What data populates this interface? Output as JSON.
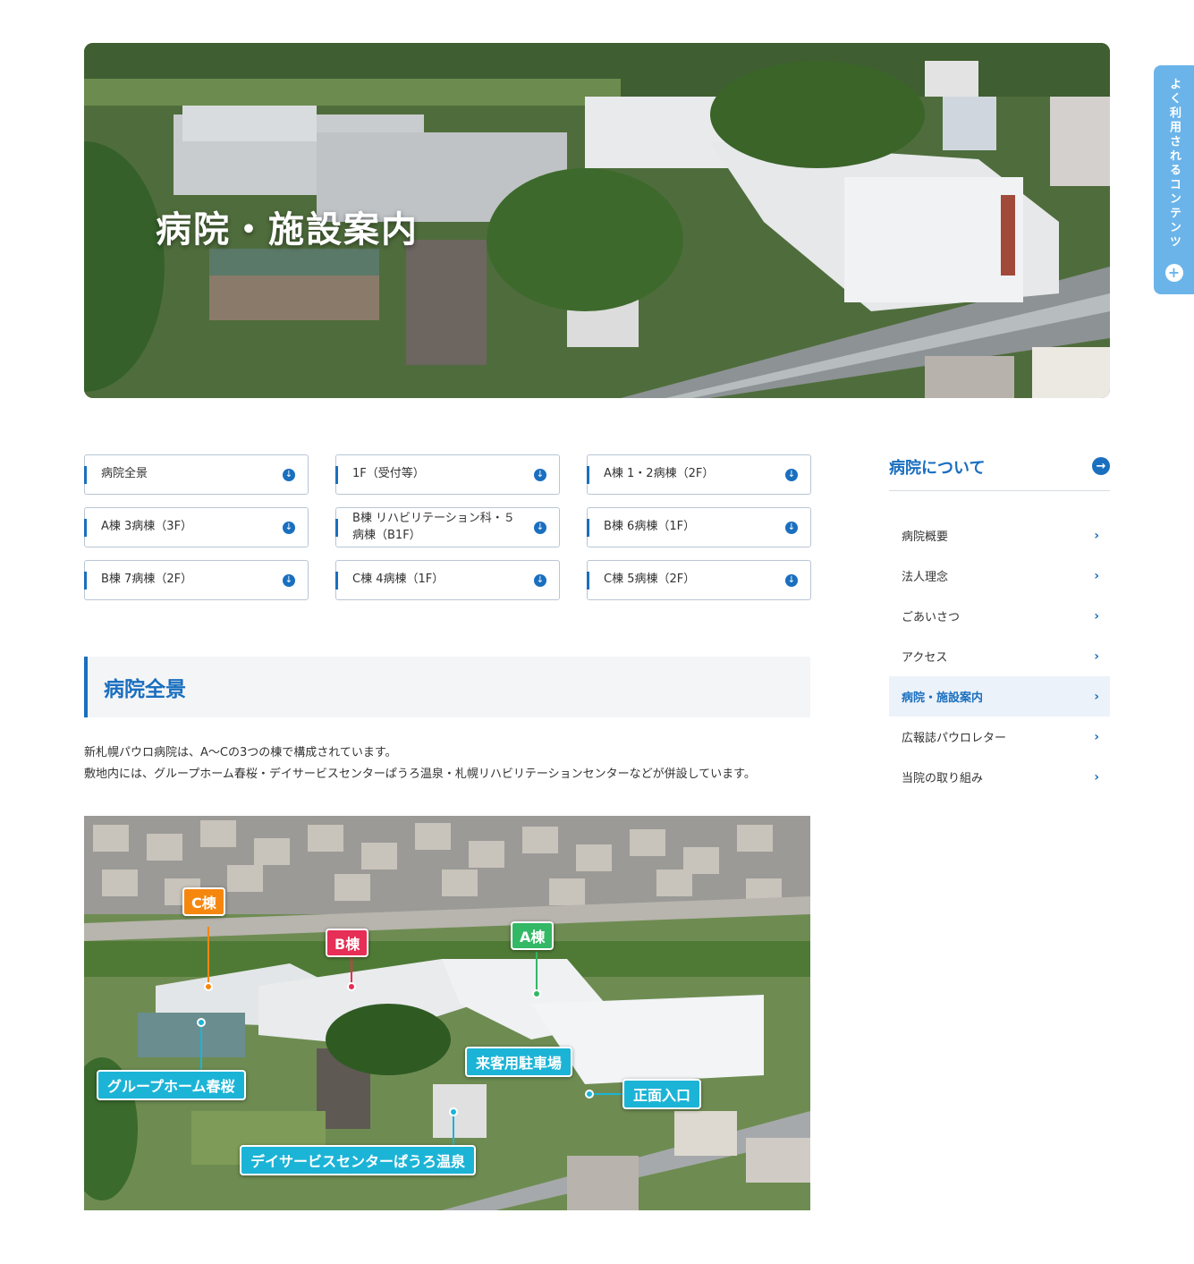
{
  "hero": {
    "title": "病院・施設案内"
  },
  "float_tab": {
    "label": "よく利用されるコンテンツ",
    "plus": "+"
  },
  "anchors": [
    {
      "label": "病院全景"
    },
    {
      "label": "1F（受付等）"
    },
    {
      "label": "A棟 1・2病棟（2F）"
    },
    {
      "label": "A棟 3病棟（3F）"
    },
    {
      "label": "B棟 リハビリテーション科・５病棟（B1F）"
    },
    {
      "label": "B棟 6病棟（1F）"
    },
    {
      "label": "B棟 7病棟（2F）"
    },
    {
      "label": "C棟 4病棟（1F）"
    },
    {
      "label": "C棟 5病棟（2F）"
    }
  ],
  "section": {
    "heading": "病院全景",
    "text_line1": "新札幌パウロ病院は、A〜Cの3つの棟で構成されています。",
    "text_line2": "敷地内には、グループホーム春桜・デイサービスセンターぱうろ温泉・札幌リハビリテーションセンターなどが併設しています。"
  },
  "map_labels": {
    "c_building": "C棟",
    "b_building": "B棟",
    "a_building": "A棟",
    "parking": "来客用駐車場",
    "entrance": "正面入口",
    "group_home": "グループホーム春桜",
    "day_service": "デイサービスセンターぱうろ温泉"
  },
  "colors": {
    "primary": "#1a6fbf",
    "float_tab": "#6ab4ea",
    "c_tag": "#f5870f",
    "b_tag": "#e62e56",
    "a_tag": "#33b866",
    "cyan_tag": "#1cb4d6"
  },
  "sidebar": {
    "title": "病院について",
    "items": [
      {
        "label": "病院概要"
      },
      {
        "label": "法人理念"
      },
      {
        "label": "ごあいさつ"
      },
      {
        "label": "アクセス"
      },
      {
        "label": "病院・施設案内",
        "active": true
      },
      {
        "label": "広報誌パウロレター"
      },
      {
        "label": "当院の取り組み"
      }
    ]
  }
}
